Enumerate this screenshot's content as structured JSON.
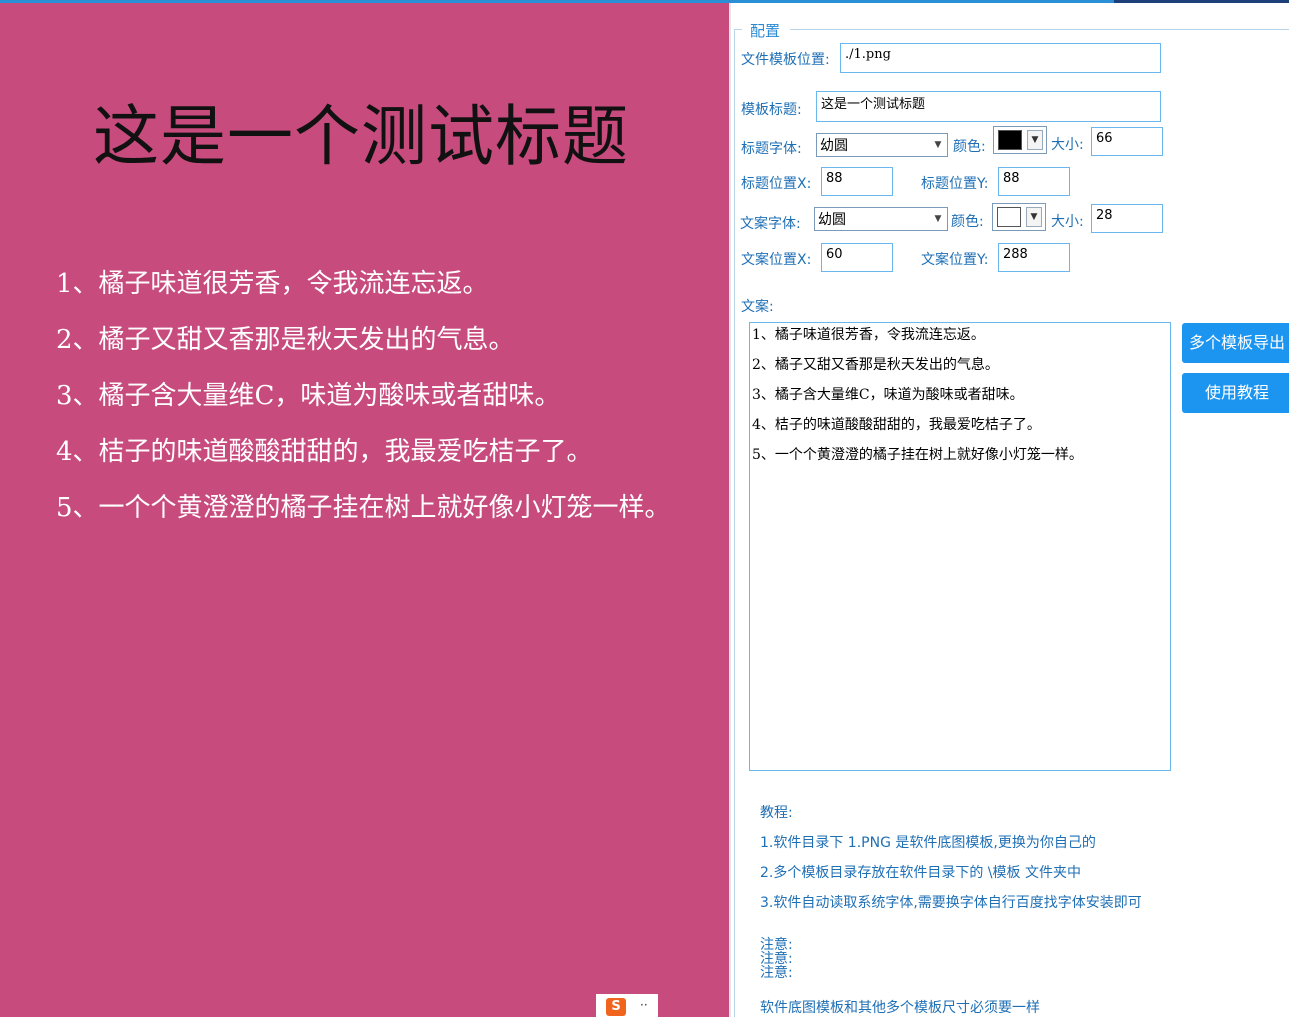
{
  "preview": {
    "title": "这是一个测试标题",
    "lines": [
      "1、橘子味道很芳香，令我流连忘返。",
      "2、橘子又甜又香那是秋天发出的气息。",
      "3、橘子含大量维C，味道为酸味或者甜味。",
      "4、桔子的味道酸酸甜甜的，我最爱吃桔子了。",
      "5、一个个黄澄澄的橘子挂在树上就好像小灯笼一样。"
    ],
    "background_color": "#c84b7e",
    "title_color": "#111111",
    "text_color": "#ffffff"
  },
  "config": {
    "legend": "配置",
    "template_path_label": "文件模板位置:",
    "template_path_value": "./1.png",
    "template_title_label": "模板标题:",
    "template_title_value": "这是一个测试标题",
    "title_font_label": "标题字体:",
    "title_font_value": "幼圆",
    "title_color_label": "颜色:",
    "title_color_value": "#000000",
    "title_size_label": "大小:",
    "title_size_value": "66",
    "title_x_label": "标题位置X:",
    "title_x_value": "88",
    "title_y_label": "标题位置Y:",
    "title_y_value": "88",
    "text_font_label": "文案字体:",
    "text_font_value": "幼圆",
    "text_color_label": "颜色:",
    "text_color_value": "#ffffff",
    "text_size_label": "大小:",
    "text_size_value": "28",
    "text_x_label": "文案位置X:",
    "text_x_value": "60",
    "text_y_label": "文案位置Y:",
    "text_y_value": "288",
    "copy_label": "文案:",
    "copy_lines": [
      "1、橘子味道很芳香，令我流连忘返。",
      "2、橘子又甜又香那是秋天发出的气息。",
      "3、橘子含大量维C，味道为酸味或者甜味。",
      "4、桔子的味道酸酸甜甜的，我最爱吃桔子了。",
      "5、一个个黄澄澄的橘子挂在树上就好像小灯笼一样。"
    ]
  },
  "buttons": {
    "export_multi": "多个模板导出",
    "tutorial": "使用教程"
  },
  "tutorial": {
    "heading": "教程:",
    "steps": [
      "1.软件目录下 1.PNG 是软件底图模板,更换为你自己的",
      "2.多个模板目录存放在软件目录下的 \\模板 文件夹中",
      "3.软件自动读取系统字体,需要换字体自行百度找字体安装即可"
    ],
    "notes": [
      "注意:",
      "注意:",
      "注意:"
    ],
    "note_text": "软件底图模板和其他多个模板尺寸必须要一样"
  },
  "accent_color": "#1c95f0",
  "ime": {
    "icon": "S",
    "dots": "··"
  }
}
